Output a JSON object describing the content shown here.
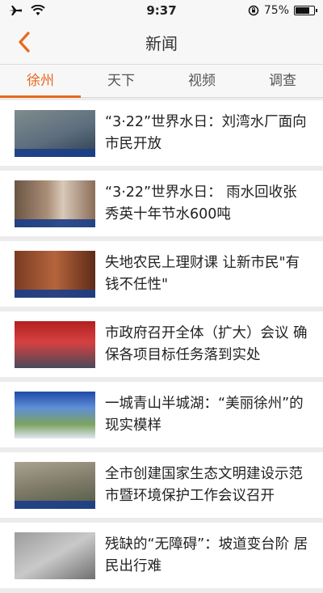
{
  "status": {
    "time": "9:37",
    "battery": "75%",
    "battery_level": 0.75
  },
  "nav": {
    "title": "新闻"
  },
  "tabs": [
    {
      "label": "徐州",
      "active": true
    },
    {
      "label": "天下",
      "active": false
    },
    {
      "label": "视频",
      "active": false
    },
    {
      "label": "调查",
      "active": false
    }
  ],
  "news": [
    {
      "title": "“3·22”世界水日：刘湾水厂面向市民开放"
    },
    {
      "title": "“3·22”世界水日： 雨水回收张秀英十年节水600吨"
    },
    {
      "title": "失地农民上理财课 让新市民\"有钱不任性\""
    },
    {
      "title": "市政府召开全体（扩大）会议 确保各项目标任务落到实处"
    },
    {
      "title": "一城青山半城湖：“美丽徐州”的现实模样"
    },
    {
      "title": "全市创建国家生态文明建设示范市暨环境保护工作会议召开"
    },
    {
      "title": "残缺的“无障碍”：坡道变台阶 居民出行难"
    }
  ],
  "colors": {
    "accent": "#e8691d"
  }
}
